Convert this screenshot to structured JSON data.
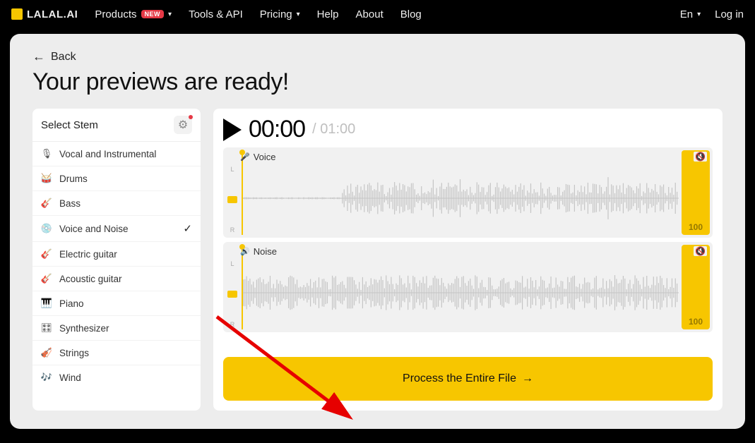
{
  "nav": {
    "logo": "LALAL.AI",
    "items": [
      "Products",
      "Tools & API",
      "Pricing",
      "Help",
      "About",
      "Blog"
    ],
    "new_badge": "NEW",
    "lang": "En",
    "login": "Log in"
  },
  "back_label": "Back",
  "heading": "Your previews are ready!",
  "sidebar": {
    "title": "Select Stem",
    "items": [
      {
        "icon": "🎙",
        "label": "Vocal and Instrumental",
        "selected": false
      },
      {
        "icon": "🥁",
        "label": "Drums",
        "selected": false
      },
      {
        "icon": "🎸",
        "label": "Bass",
        "selected": false
      },
      {
        "icon": "💿",
        "label": "Voice and Noise",
        "selected": true
      },
      {
        "icon": "🎸",
        "label": "Electric guitar",
        "selected": false
      },
      {
        "icon": "🎸",
        "label": "Acoustic guitar",
        "selected": false
      },
      {
        "icon": "🎹",
        "label": "Piano",
        "selected": false
      },
      {
        "icon": "🎛",
        "label": "Synthesizer",
        "selected": false
      },
      {
        "icon": "🎻",
        "label": "Strings",
        "selected": false
      },
      {
        "icon": "🎶",
        "label": "Wind",
        "selected": false
      }
    ]
  },
  "player": {
    "current": "00:00",
    "total": "01:00"
  },
  "tracks": [
    {
      "name": "Voice",
      "icon": "🎤",
      "volume": "100",
      "pattern": "sparse"
    },
    {
      "name": "Noise",
      "icon": "🔊",
      "volume": "100",
      "pattern": "dense"
    }
  ],
  "process_label": "Process the Entire File"
}
